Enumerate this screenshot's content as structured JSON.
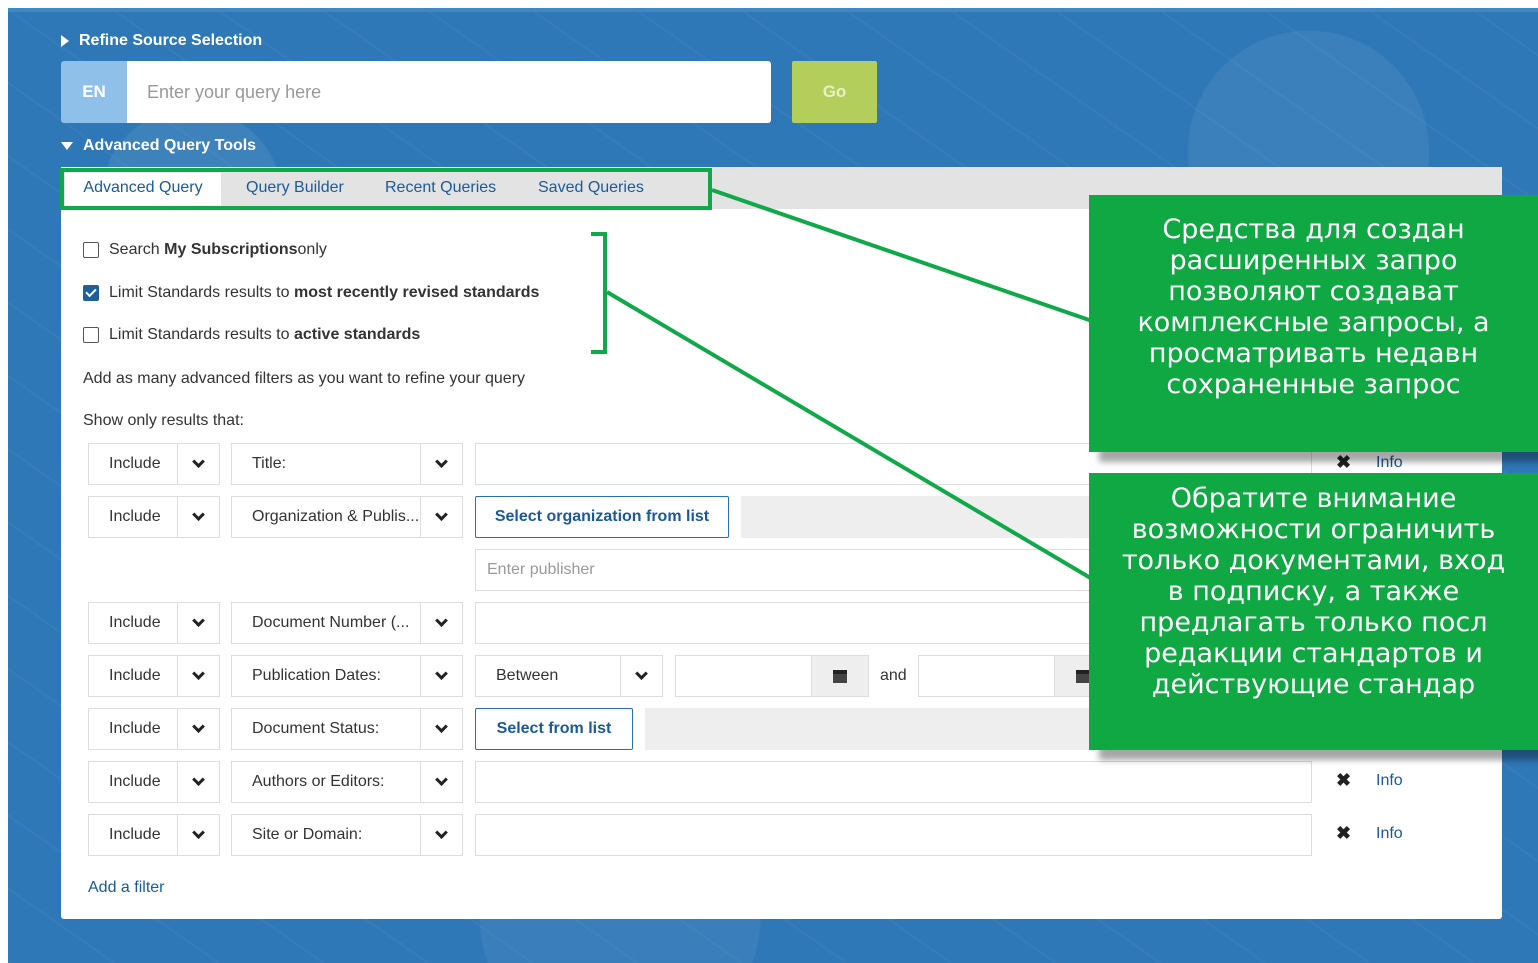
{
  "refine_label": "Refine Source Selection",
  "search": {
    "lang": "EN",
    "placeholder": "Enter your query here",
    "go_label": "Go"
  },
  "advanced_label": "Advanced Query Tools",
  "tabs": [
    {
      "label": "Advanced Query",
      "active": true
    },
    {
      "label": "Query Builder"
    },
    {
      "label": "Recent Queries"
    },
    {
      "label": "Saved Queries"
    }
  ],
  "options": {
    "subscriptions": {
      "pre": "Search ",
      "bold": "My Subscriptions",
      "post": " only",
      "checked": false
    },
    "revised": {
      "pre": "Limit Standards results to ",
      "bold": "most recently revised standards",
      "checked": true
    },
    "active": {
      "pre": "Limit Standards results to ",
      "bold": "active standards",
      "checked": false
    }
  },
  "hint": "Add as many advanced filters as you want to refine your query",
  "show_only": "Show only results that:",
  "filters": [
    {
      "include": "Include",
      "field": "Title:"
    },
    {
      "include": "Include",
      "field": "Organization & Publis...",
      "button": "Select organization from list",
      "publisher_placeholder": "Enter publisher"
    },
    {
      "include": "Include",
      "field": "Document Number (..."
    },
    {
      "include": "Include",
      "field": "Publication Dates:",
      "range": "Between",
      "and": "and"
    },
    {
      "include": "Include",
      "field": "Document Status:",
      "button": "Select from list"
    },
    {
      "include": "Include",
      "field": "Authors or Editors:"
    },
    {
      "include": "Include",
      "field": "Site or Domain:"
    }
  ],
  "row_actions": {
    "remove_icon": "times-icon",
    "info": "Info"
  },
  "add_filter": "Add a filter",
  "callouts": {
    "top": [
      "Средства для создан",
      "расширенных запро",
      "позволяют создават",
      "комплексные запросы, а",
      "просматривать недавн",
      "сохраненные запрос"
    ],
    "bottom": [
      "Обратите внимание",
      "возможности ограничить",
      "только документами, вход",
      "в подписку, а также",
      "предлагать только посл",
      "редакции стандартов и",
      "действующие стандар"
    ]
  },
  "colors": {
    "accent": "#2f78b7",
    "callout": "#0fa842",
    "go": "#b3ce5b",
    "link": "#1a5a9a"
  }
}
